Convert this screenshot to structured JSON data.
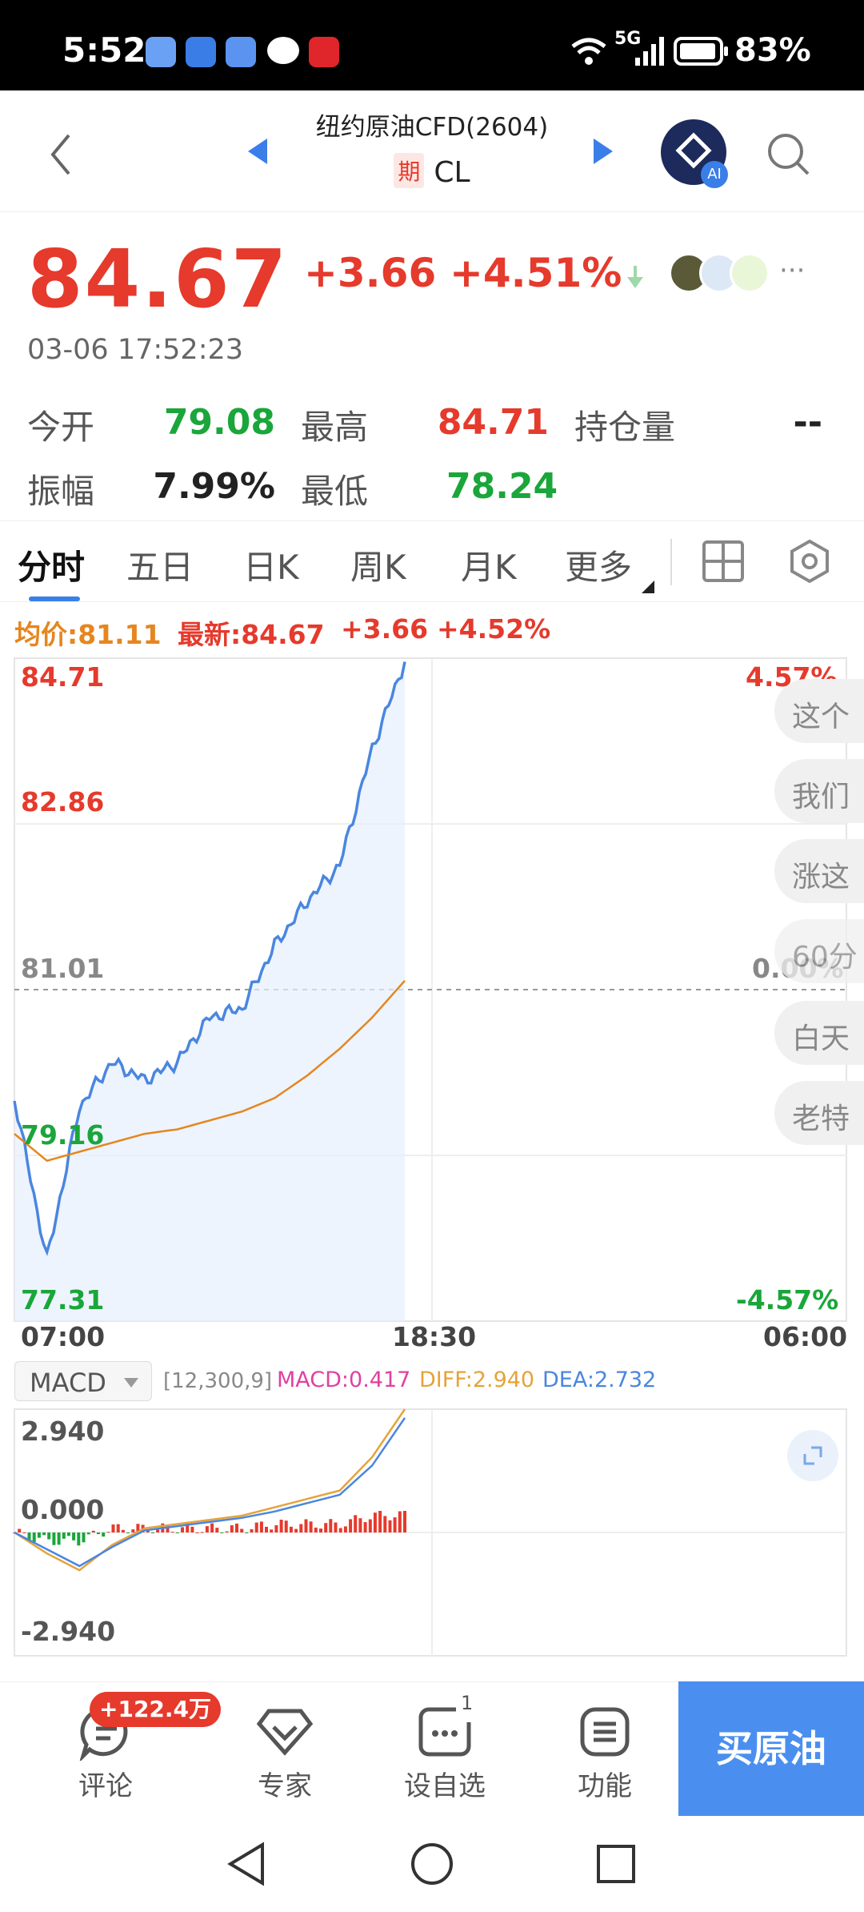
{
  "status_bar": {
    "time": "5:52",
    "network": "5G",
    "battery": "83%"
  },
  "header": {
    "title": "纽约原油CFD(2604)",
    "tag": "期",
    "code": "CL",
    "ai_badge": "AI"
  },
  "quote": {
    "price": "84.67",
    "change": "+3.66",
    "change_pct": "+4.51%",
    "timestamp": "03-06 17:52:23",
    "stats": [
      {
        "label": "今开",
        "value": "79.08",
        "color": "#1aa63a"
      },
      {
        "label": "最高",
        "value": "84.71",
        "color": "#e53a2c"
      },
      {
        "label": "持仓量",
        "value": "--",
        "color": "#222222"
      },
      {
        "label": "振幅",
        "value": "7.99%",
        "color": "#222222"
      },
      {
        "label": "最低",
        "value": "78.24",
        "color": "#1aa63a"
      }
    ]
  },
  "tabs": [
    "分时",
    "五日",
    "日K",
    "周K",
    "月K",
    "更多"
  ],
  "chart": {
    "legend": {
      "avg": "均价:81.11",
      "latest": "最新:84.67",
      "chg": "+3.66",
      "pct": "+4.52%"
    },
    "y_left": [
      "84.71",
      "82.86",
      "81.01",
      "79.16",
      "77.31"
    ],
    "y_right": [
      "4.57%",
      "0.00%",
      "-4.57%"
    ],
    "x_labels": [
      "07:00",
      "18:30",
      "06:00"
    ],
    "bubbles": [
      "这个",
      "我们",
      "涨这",
      "60分",
      "白天",
      "老特"
    ]
  },
  "chart_data": [
    {
      "type": "line",
      "series": [
        {
          "name": "最新",
          "color": "#4a86e0",
          "x": [
            "07:00",
            "08:00",
            "09:00",
            "10:00",
            "11:00",
            "12:00",
            "13:00",
            "14:00",
            "15:00",
            "16:00",
            "17:00",
            "17:30",
            "17:52"
          ],
          "values": [
            79.8,
            78.0,
            79.7,
            80.2,
            80.0,
            80.2,
            80.7,
            80.8,
            81.5,
            82.0,
            82.4,
            83.7,
            84.67
          ]
        },
        {
          "name": "均价",
          "color": "#e5861f",
          "x": [
            "07:00",
            "08:00",
            "09:00",
            "10:00",
            "11:00",
            "12:00",
            "13:00",
            "14:00",
            "15:00",
            "16:00",
            "17:00",
            "17:30",
            "17:52"
          ],
          "values": [
            79.4,
            79.1,
            79.2,
            79.3,
            79.4,
            79.45,
            79.55,
            79.65,
            79.8,
            80.05,
            80.35,
            80.7,
            81.11
          ]
        }
      ],
      "ylim": [
        77.31,
        84.71
      ],
      "x_range": [
        "07:00",
        "06:00"
      ]
    },
    {
      "type": "line",
      "indicator": "MACD",
      "params": "[12,300,9]",
      "macd": "MACD:0.417",
      "diff": "DIFF:2.940",
      "dea": "DEA:2.732",
      "y_labels": [
        "2.940",
        "0.000",
        "-2.940"
      ],
      "ylim": [
        -2.94,
        2.94
      ],
      "series": [
        {
          "name": "DIFF",
          "color": "#e5a33a",
          "values": [
            0.0,
            -0.5,
            -0.9,
            -0.3,
            0.1,
            0.2,
            0.3,
            0.4,
            0.6,
            0.8,
            1.0,
            1.8,
            2.94
          ]
        },
        {
          "name": "DEA",
          "color": "#4a86e0",
          "values": [
            0.0,
            -0.4,
            -0.8,
            -0.35,
            0.05,
            0.15,
            0.25,
            0.35,
            0.5,
            0.7,
            0.9,
            1.6,
            2.732
          ]
        }
      ]
    }
  ],
  "bottom": {
    "comment": "评论",
    "badge": "+122.4万",
    "expert": "专家",
    "watch": "设自选",
    "watch_count": "1",
    "func": "功能",
    "buy": "买原油"
  }
}
